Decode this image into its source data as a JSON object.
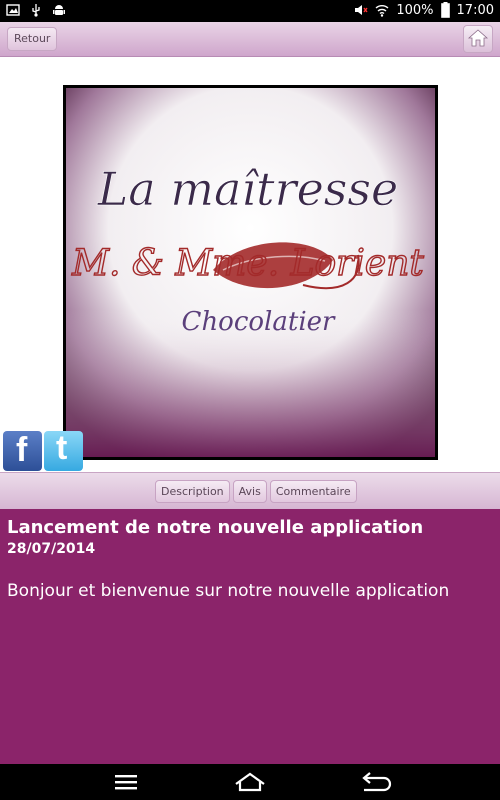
{
  "status_bar": {
    "battery": "100%",
    "time": "17:00",
    "icons": [
      "image-icon",
      "usb-icon",
      "android-icon",
      "mute-icon",
      "wifi-icon",
      "signal-icon",
      "battery-icon"
    ]
  },
  "header": {
    "back_label": "Retour",
    "home_icon": "home-icon"
  },
  "logo": {
    "line1": "La maîtresse",
    "line2": "M. & Mme. Lorient",
    "line3": "Chocolatier"
  },
  "social": {
    "facebook_letter": "f",
    "twitter_letter": "t"
  },
  "tabs": [
    "Description",
    "Avis",
    "Commentaire"
  ],
  "article": {
    "title": "Lancement de notre nouvelle application",
    "date": "28/07/2014",
    "body": "Bonjour et bienvenue sur notre nouvelle application"
  },
  "colors": {
    "content_bg": "#8b246a",
    "header_gradient_top": "#e9d4e6",
    "header_gradient_bottom": "#cfa6cc"
  }
}
